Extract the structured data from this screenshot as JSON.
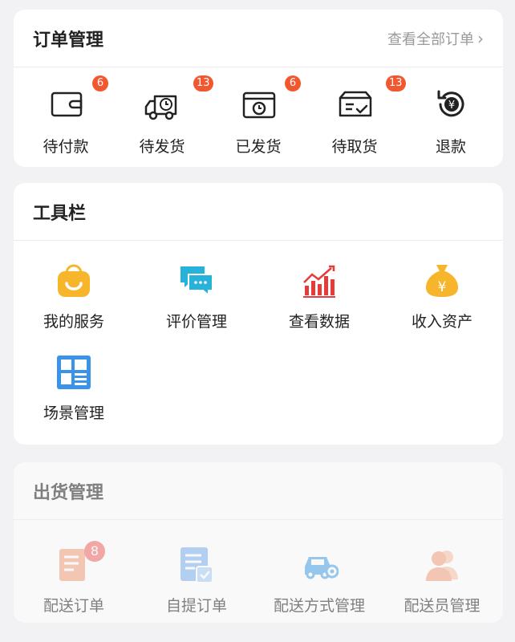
{
  "orders": {
    "title": "订单管理",
    "more_label": "查看全部订单",
    "items": [
      {
        "label": "待付款",
        "badge": "6",
        "icon": "wallet-icon"
      },
      {
        "label": "待发货",
        "badge": "13",
        "icon": "delivery-truck-icon"
      },
      {
        "label": "已发货",
        "badge": "6",
        "icon": "clock-box-icon"
      },
      {
        "label": "待取货",
        "badge": "13",
        "icon": "pickup-box-icon"
      },
      {
        "label": "退款",
        "badge": "",
        "icon": "refund-icon"
      }
    ]
  },
  "tools": {
    "title": "工具栏",
    "items": [
      {
        "label": "我的服务",
        "icon": "service-bag-icon",
        "color": "#f7b52c"
      },
      {
        "label": "评价管理",
        "icon": "chat-bubbles-icon",
        "color": "#27b3d9"
      },
      {
        "label": "查看数据",
        "icon": "bar-chart-icon",
        "color": "#e63b3b"
      },
      {
        "label": "收入资产",
        "icon": "money-bag-icon",
        "color": "#f7b52c"
      },
      {
        "label": "场景管理",
        "icon": "layout-grid-icon",
        "color": "#3a93e8"
      }
    ]
  },
  "shipping": {
    "title": "出货管理",
    "items": [
      {
        "label": "配送订单",
        "badge": "8",
        "icon": "delivery-order-icon",
        "color": "#f4a27e"
      },
      {
        "label": "自提订单",
        "badge": "",
        "icon": "self-pickup-icon",
        "color": "#7fb3ef"
      },
      {
        "label": "配送方式管理",
        "badge": "",
        "icon": "car-settings-icon",
        "color": "#4aa3e6"
      },
      {
        "label": "配送员管理",
        "badge": "",
        "icon": "courier-users-icon",
        "color": "#f4a27e"
      }
    ]
  }
}
